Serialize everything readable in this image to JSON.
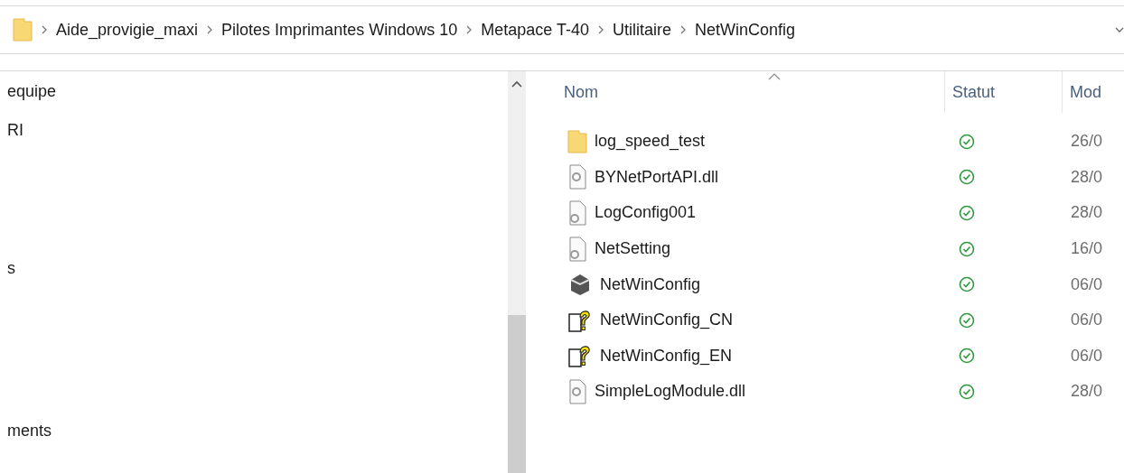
{
  "breadcrumb": [
    "Aide_provigie_maxi",
    "Pilotes Imprimantes Windows 10",
    "Metapace T-40",
    "Utilitaire",
    "NetWinConfig"
  ],
  "nav_pane": {
    "items": [
      {
        "label": "equipe"
      },
      {
        "label": "RI"
      },
      {
        "label": "s"
      },
      {
        "label": "ments"
      }
    ]
  },
  "file_list": {
    "columns": [
      "Nom",
      "Statut",
      "Mod"
    ],
    "rows": [
      {
        "name": "log_speed_test",
        "kind": "folder",
        "date": "26/0"
      },
      {
        "name": "BYNetPortAPI.dll",
        "kind": "dll",
        "date": "28/0"
      },
      {
        "name": "LogConfig001",
        "kind": "config",
        "date": "28/0"
      },
      {
        "name": "NetSetting",
        "kind": "config",
        "date": "16/0"
      },
      {
        "name": "NetWinConfig",
        "kind": "app",
        "date": "06/0"
      },
      {
        "name": "NetWinConfig_CN",
        "kind": "help",
        "date": "06/0"
      },
      {
        "name": "NetWinConfig_EN",
        "kind": "help",
        "date": "06/0"
      },
      {
        "name": "SimpleLogModule.dll",
        "kind": "dll",
        "date": "28/0"
      }
    ]
  }
}
